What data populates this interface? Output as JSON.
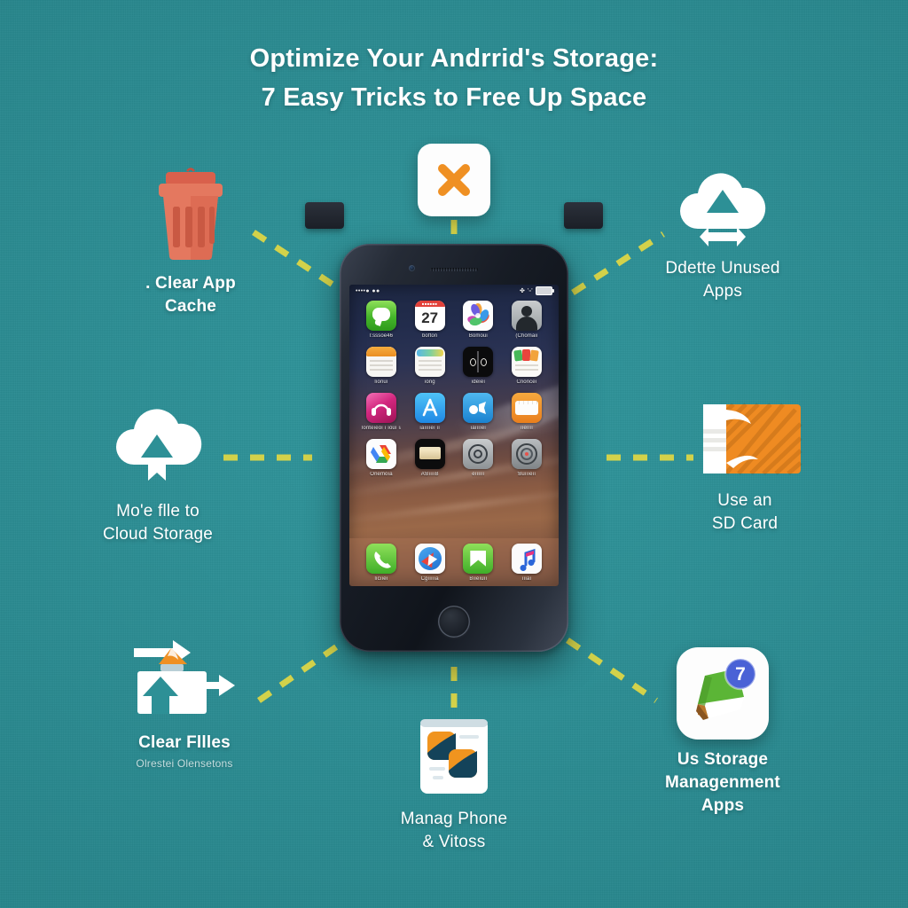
{
  "theme": {
    "background_color": "#2d9096",
    "title_color": "#ffffff",
    "dash_color": "#d3d24a",
    "trash_color": "#e0705a",
    "orange_accent": "#ef9023",
    "sd_card_color": "#ef8b22",
    "badge_color": "#4a62d6",
    "book_green": "#5bb536"
  },
  "title": {
    "line1": "Optimize Your Andrrid's Storage:",
    "line2": "7 Easy Tricks to Free Up Space"
  },
  "nodes": [
    {
      "id": "clear-app-cache",
      "icon": "trash-icon",
      "label": ". Clear App\nCache",
      "sub": ""
    },
    {
      "id": "close-apps",
      "icon": "close-x-icon",
      "label": "",
      "sub": ""
    },
    {
      "id": "delete-unused-apps",
      "icon": "cloud-delete-icon",
      "label": "Ddette Unused\nApps",
      "sub": ""
    },
    {
      "id": "move-files-to-cloud",
      "icon": "cloud-upload-icon",
      "label": "Mo'e flle to\nCloud Storage",
      "sub": ""
    },
    {
      "id": "use-an-sd-card",
      "icon": "sd-card-icon",
      "label": "Use an\nSD Card",
      "sub": ""
    },
    {
      "id": "clear-files",
      "icon": "file-transfer-icon",
      "label": "Clear Fllles",
      "sub": "Olrestei Olensetons"
    },
    {
      "id": "manage-photos-videos",
      "icon": "photos-card-icon",
      "label": "Manag Phone\n& Vitoss",
      "sub": ""
    },
    {
      "id": "storage-management-apps",
      "icon": "storage-app-icon",
      "label": "Us Storage\nManagenment\nApps",
      "sub": "",
      "badge": "7"
    }
  ],
  "phone": {
    "status_bar": {
      "carrier": "••••●  ●●",
      "right_info": "✤  '▫'"
    },
    "app_rows": [
      [
        {
          "name": "messages-app-icon",
          "label": "l:sssoe46"
        },
        {
          "name": "calendar-app-icon",
          "label": "bofton",
          "day": "27",
          "month": "■■■■■■"
        },
        {
          "name": "photos-app-icon",
          "label": "Bomoui"
        },
        {
          "name": "contacts-app-icon",
          "label": "(Ćhomaiı"
        }
      ],
      [
        {
          "name": "reminders-app-icon",
          "label": "lıonuı"
        },
        {
          "name": "notes-app-icon",
          "label": "ıonɡ"
        },
        {
          "name": "clock-app-icon",
          "label": "ıdeıeı"
        },
        {
          "name": "news-app-icon",
          "label": "Cnonceı"
        }
      ],
      [
        {
          "name": "music-app-icon",
          "label": "lonteıeoı ı ıouı ıaıııı"
        },
        {
          "name": "appstore-app-icon",
          "label": "ıaııııeı ıı"
        },
        {
          "name": "twitter-app-icon",
          "label": "ıaııııeı"
        },
        {
          "name": "notes2-app-icon",
          "label": "ııeıııı"
        }
      ],
      [
        {
          "name": "drive-app-icon",
          "label": "Onemoıa"
        },
        {
          "name": "wallet-app-icon",
          "label": "AƁııııB"
        },
        {
          "name": "settings-app-icon",
          "label": "eıııııı"
        },
        {
          "name": "compass-app-icon",
          "label": "Ɓuıııeıı"
        }
      ]
    ],
    "dock": [
      {
        "name": "phone-app-icon",
        "label": "lıcııeı"
      },
      {
        "name": "safari-app-icon",
        "label": "Cɡıııııa"
      },
      {
        "name": "mail-app-icon",
        "label": "Bııeıuıı"
      },
      {
        "name": "music2-app-icon",
        "label": "ıııaı"
      }
    ]
  }
}
